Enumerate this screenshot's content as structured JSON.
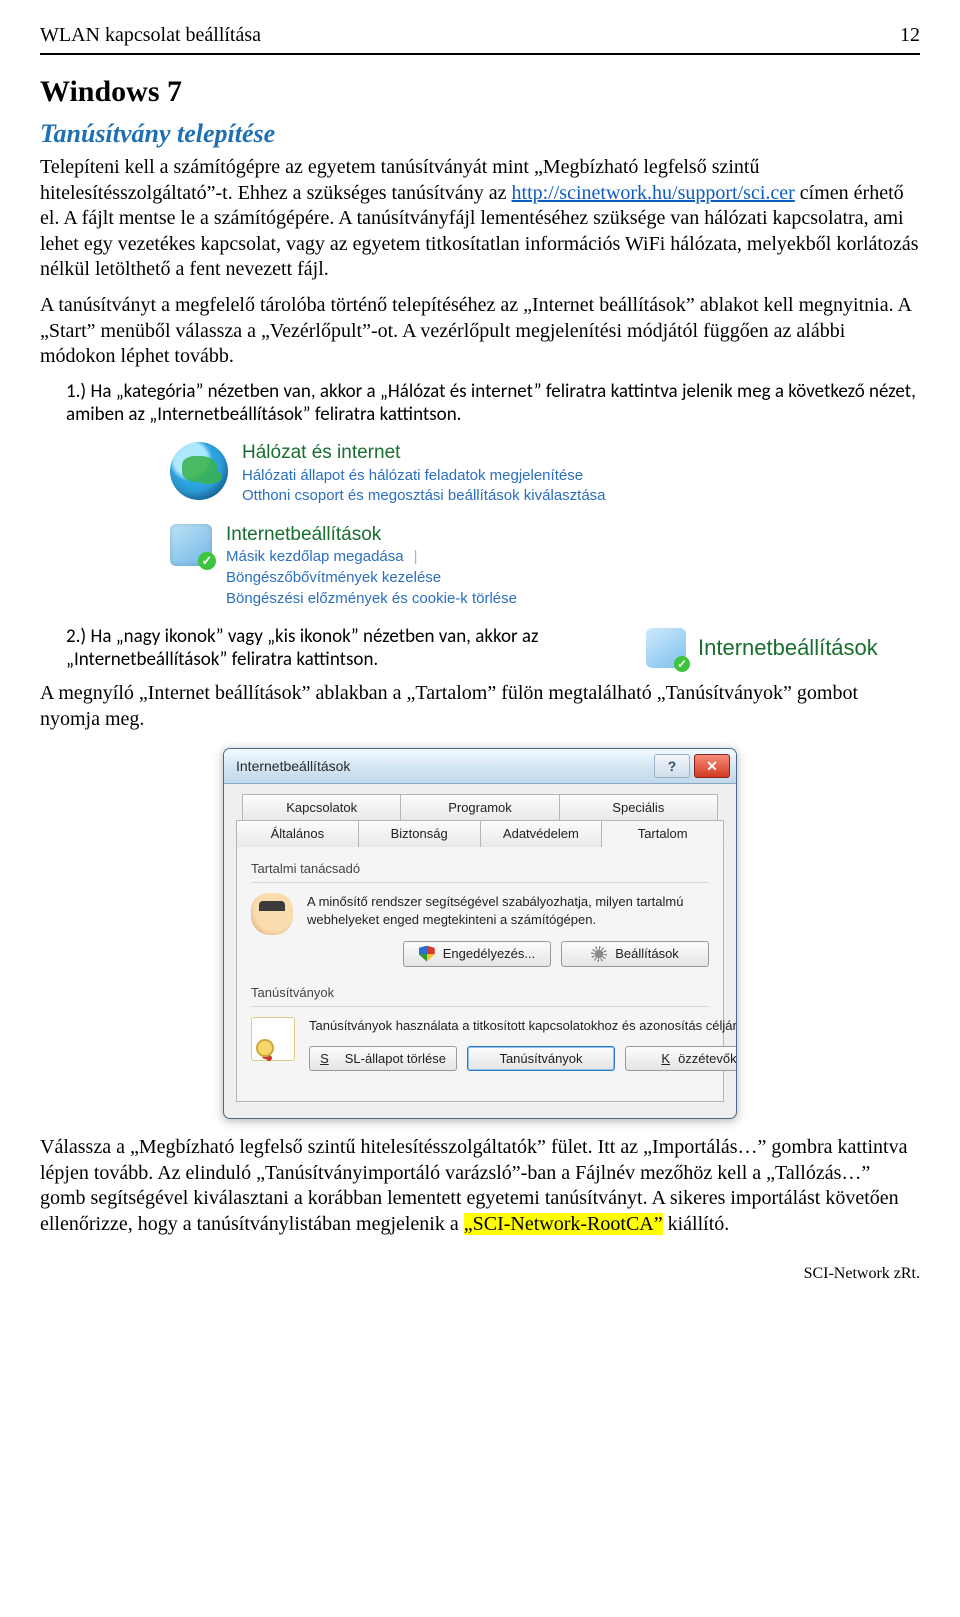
{
  "header": {
    "title": "WLAN kapcsolat beállítása",
    "page": "12"
  },
  "h1": "Windows 7",
  "h2": "Tanúsítvány telepítése",
  "p1a": "Telepíteni kell a számítógépre az egyetem tanúsítványát mint „Megbízható legfelső szintű hitelesítésszolgáltató”-t. Ehhez a szükséges tanúsítvány az ",
  "cert_link": "http://scinetwork.hu/support/sci.cer",
  "p1b": " címen érhető el. A fájlt mentse le a számítógépére. A tanúsítványfájl lementéséhez szüksége van hálózati kapcsolatra, ami lehet egy vezetékes kapcsolat, vagy az egyetem titkosítatlan információs WiFi hálózata, melyekből korlátozás nélkül letölthető a fent nevezett fájl.",
  "p2": "A tanúsítványt a megfelelő tárolóba történő telepítéséhez az „Internet beállítások” ablakot kell megnyitnia. A „Start” menüből válassza a „Vezérlőpult”-ot. A vezérlőpult megjelenítési módjától függően az alábbi módokon léphet tovább.",
  "li1_pre": "1.)  Ha „kategória” nézetben van, akkor a „Hálózat és internet” feliratra kattintva jelenik meg a következő nézet, amiben az „Internetbeállítások” feliratra kattintson.",
  "cp1": {
    "heading1": "Hálózat és internet",
    "sub1a": "Hálózati állapot és hálózati feladatok megjelenítése",
    "sub1b": "Otthoni csoport és megosztási beállítások kiválasztása",
    "heading2": "Internetbeállítások",
    "links": [
      "Másik kezdőlap megadása",
      "Böngészőbővítmények kezelése",
      "Böngészési előzmények és cookie-k törlése"
    ]
  },
  "li2": "2.)  Ha „nagy ikonok” vagy „kis ikonok” nézetben van, akkor az „Internetbeállítások” feliratra kattintson.",
  "ib_chip": "Internetbeállítások",
  "p3": "A megnyíló „Internet beállítások” ablakban a „Tartalom” fülön megtalálható „Tanúsítványok” gombot nyomja meg.",
  "dialog": {
    "title": "Internetbeállítások",
    "tabs_top": [
      "Kapcsolatok",
      "Programok",
      "Speciális"
    ],
    "tabs_bottom": [
      "Általános",
      "Biztonság",
      "Adatvédelem",
      "Tartalom"
    ],
    "grp1": {
      "title": "Tartalmi tanácsadó",
      "desc": "A minősítő rendszer segítségével szabályozhatja, milyen tartalmú webhelyeket enged megtekinteni a számítógépen.",
      "btn1": "Engedélyezés...",
      "btn2": "Beállítások"
    },
    "grp2": {
      "title": "Tanúsítványok",
      "desc": "Tanúsítványok használata a titkosított kapcsolatokhoz és azonosítás céljára.",
      "btn1": "SSL-állapot törlése",
      "btn2": "Tanúsítványok",
      "btn3": "Közzétevők"
    }
  },
  "p4a": "Válassza a „Megbízható legfelső szintű hitelesítésszolgáltatók” fület. Itt az „Importálás…” gombra kattintva lépjen tovább. Az elinduló „Tanúsítványimportáló varázsló”-ban a Fájlnév mezőhöz kell a „Tallózás…” gomb segítségével kiválasztani a korábban lementett egyetemi tanúsítványt. A sikeres importálást követően ellenőrizze, hogy a tanúsítványlistában megjelenik a ",
  "p4_hl": "„SCI-Network-RootCA”",
  "p4b": " kiállító.",
  "footer": "SCI-Network zRt."
}
